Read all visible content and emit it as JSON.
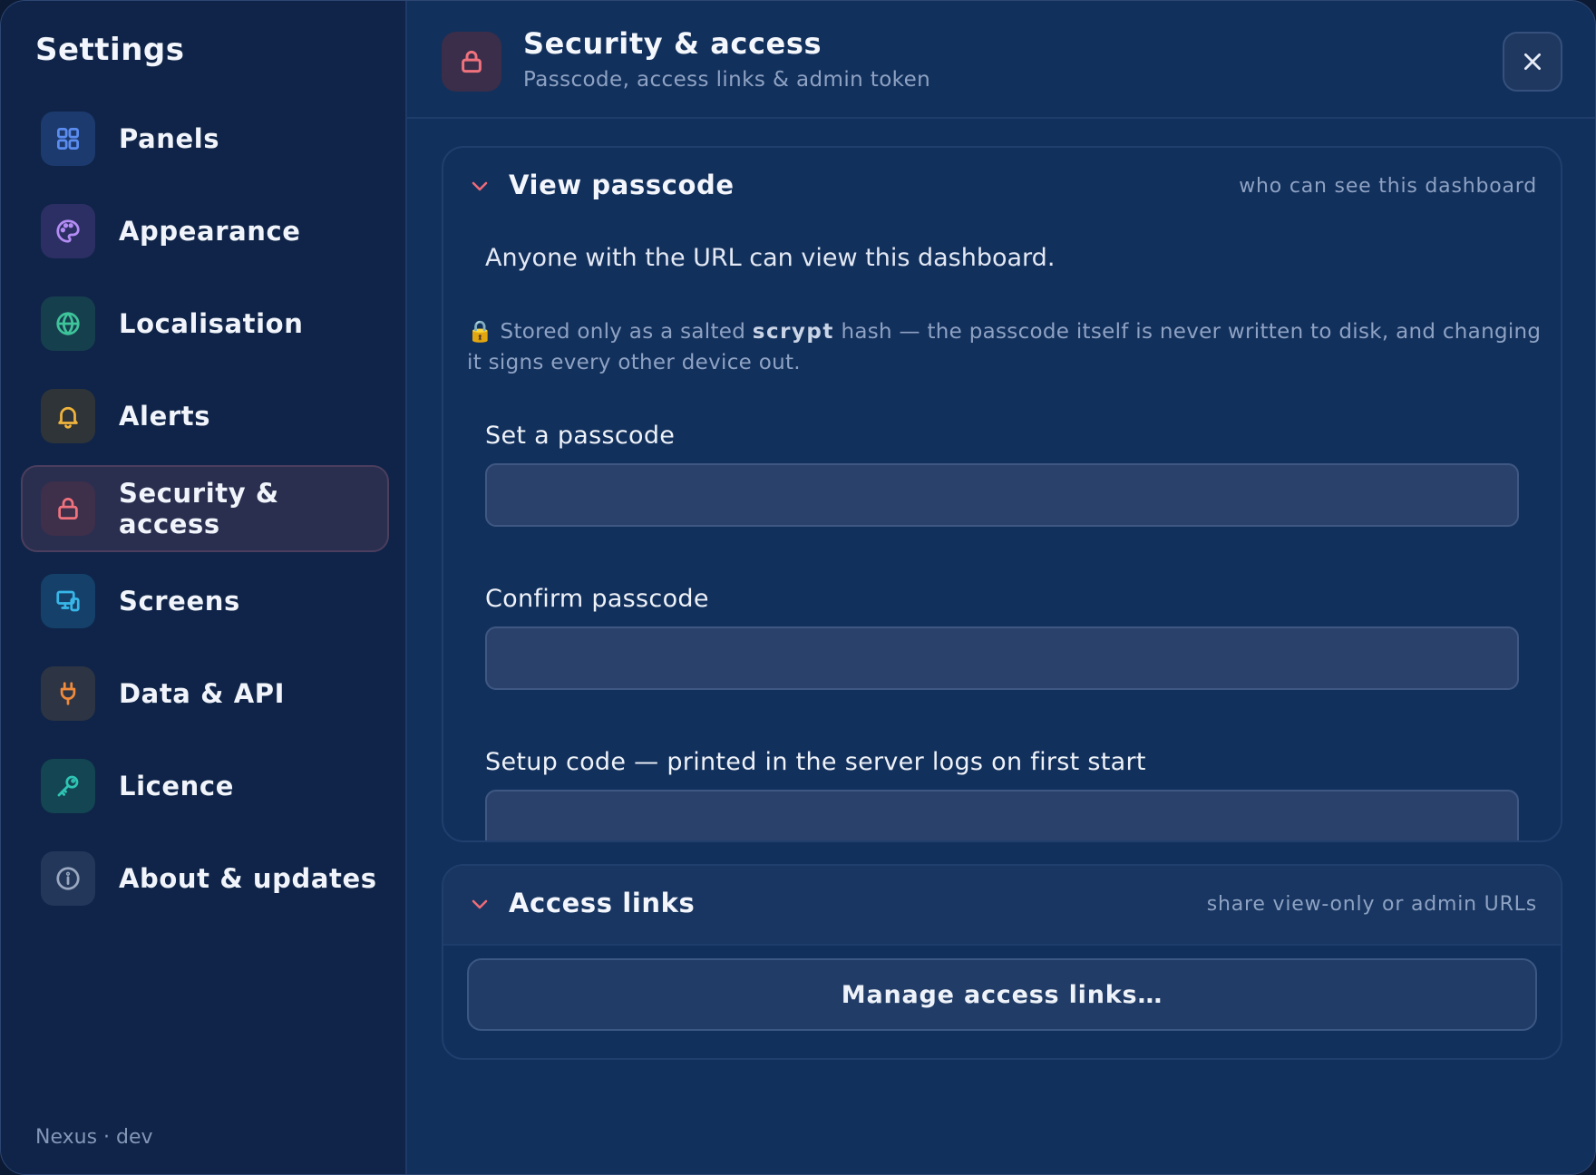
{
  "sidebar": {
    "title": "Settings",
    "items": [
      {
        "label": "Panels",
        "icon": "grid-icon",
        "color": "#5b8cf0",
        "bg": "#1c3a6e"
      },
      {
        "label": "Appearance",
        "icon": "palette-icon",
        "color": "#b48cf5",
        "bg": "#2c2f63"
      },
      {
        "label": "Localisation",
        "icon": "globe-icon",
        "color": "#3ec49a",
        "bg": "#163f4e"
      },
      {
        "label": "Alerts",
        "icon": "bell-icon",
        "color": "#f0b43c",
        "bg": "#2f3438"
      },
      {
        "label": "Security & access",
        "icon": "lock-icon",
        "color": "#f0727d",
        "bg": "#3e2f4a"
      },
      {
        "label": "Screens",
        "icon": "devices-icon",
        "color": "#38b6e8",
        "bg": "#14406a"
      },
      {
        "label": "Data & API",
        "icon": "plug-icon",
        "color": "#f08a3c",
        "bg": "#2d3443"
      },
      {
        "label": "Licence",
        "icon": "key-icon",
        "color": "#2fc4b4",
        "bg": "#134552"
      },
      {
        "label": "About & updates",
        "icon": "info-icon",
        "color": "#9aa8c0",
        "bg": "#22375a"
      }
    ],
    "active_index": 4,
    "footer": "Nexus · dev"
  },
  "header": {
    "icon": "lock-icon",
    "title": "Security & access",
    "subtitle": "Passcode, access links & admin token",
    "close_icon": "close-icon"
  },
  "view_passcode": {
    "title": "View passcode",
    "hint": "who can see this dashboard",
    "description": "Anyone with the URL can view this dashboard.",
    "note_prefix": "🔒 Stored only as a salted ",
    "note_bold": "scrypt",
    "note_suffix": " hash — the passcode itself is never written to disk, and changing it signs every other device out.",
    "set_label": "Set a passcode",
    "set_value": "",
    "confirm_label": "Confirm passcode",
    "confirm_value": "",
    "setup_label": "Setup code — printed in the server logs on first start",
    "setup_value": ""
  },
  "access_links": {
    "title": "Access links",
    "hint": "share view-only or admin URLs",
    "button_label": "Manage access links…"
  },
  "colors": {
    "accent": "#f0727d",
    "background": "#12305c",
    "sidebar": "#0f2448"
  }
}
